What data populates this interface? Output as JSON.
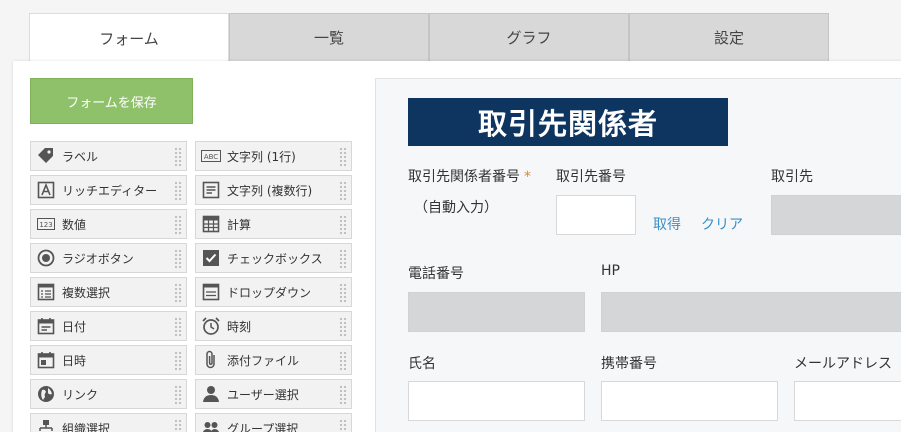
{
  "tabs": [
    "フォーム",
    "一覧",
    "グラフ",
    "設定"
  ],
  "save_button": "フォームを保存",
  "palette_left": [
    {
      "label": "ラベル",
      "icon": "tag-icon"
    },
    {
      "label": "リッチエディター",
      "icon": "rich-editor-icon"
    },
    {
      "label": "数値",
      "icon": "number-icon"
    },
    {
      "label": "ラジオボタン",
      "icon": "radio-icon"
    },
    {
      "label": "複数選択",
      "icon": "multi-select-icon"
    },
    {
      "label": "日付",
      "icon": "calendar-icon"
    },
    {
      "label": "日時",
      "icon": "datetime-icon"
    },
    {
      "label": "リンク",
      "icon": "globe-icon"
    },
    {
      "label": "組織選択",
      "icon": "organization-icon"
    }
  ],
  "palette_right": [
    {
      "label": "文字列 (1行)",
      "icon": "abc-icon"
    },
    {
      "label": "文字列 (複数行)",
      "icon": "multiline-text-icon"
    },
    {
      "label": "計算",
      "icon": "calculator-icon"
    },
    {
      "label": "チェックボックス",
      "icon": "checkbox-icon"
    },
    {
      "label": "ドロップダウン",
      "icon": "dropdown-icon"
    },
    {
      "label": "時刻",
      "icon": "alarm-clock-icon"
    },
    {
      "label": "添付ファイル",
      "icon": "paperclip-icon"
    },
    {
      "label": "ユーザー選択",
      "icon": "user-icon"
    },
    {
      "label": "グループ選択",
      "icon": "group-icon"
    }
  ],
  "form": {
    "title": "取引先関係者",
    "contact_number_label": "取引先関係者番号",
    "required_mark": "*",
    "auto_input": "（自動入力）",
    "client_number_label": "取引先番号",
    "fetch_link": "取得",
    "clear_link": "クリア",
    "client_label": "取引先",
    "phone_label": "電話番号",
    "hp_label": "HP",
    "name_label": "氏名",
    "mobile_label": "携帯番号",
    "email_label": "メールアドレス"
  }
}
